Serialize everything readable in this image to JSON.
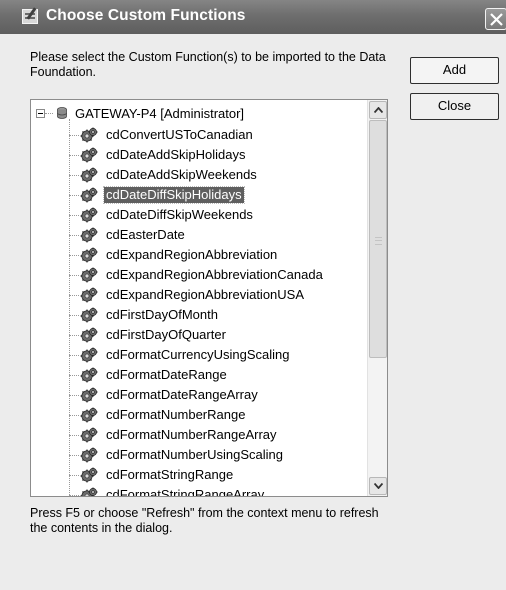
{
  "window": {
    "title": "Choose Custom Functions",
    "instructions": "Please select the Custom Function(s) to be imported to the Data Foundation.",
    "hint": "Press F5 or choose \"Refresh\" from the context menu to refresh the contents in the dialog."
  },
  "buttons": {
    "add": "Add",
    "close": "Close"
  },
  "tree": {
    "root_label": "GATEWAY-P4 [Administrator]",
    "selected_index": 3,
    "items": [
      "cdConvertUSToCanadian",
      "cdDateAddSkipHolidays",
      "cdDateAddSkipWeekends",
      "cdDateDiffSkipHolidays",
      "cdDateDiffSkipWeekends",
      "cdEasterDate",
      "cdExpandRegionAbbreviation",
      "cdExpandRegionAbbreviationCanada",
      "cdExpandRegionAbbreviationUSA",
      "cdFirstDayOfMonth",
      "cdFirstDayOfQuarter",
      "cdFormatCurrencyUsingScaling",
      "cdFormatDateRange",
      "cdFormatDateRangeArray",
      "cdFormatNumberRange",
      "cdFormatNumberRangeArray",
      "cdFormatNumberUsingScaling",
      "cdFormatStringRange",
      "cdFormatStringRangeArray"
    ]
  },
  "icons": {
    "app": "dialog-app-icon",
    "close": "close-icon",
    "collapse": "collapse-minus-icon",
    "database": "database-icon",
    "function": "custom-function-icon",
    "scroll_up": "scroll-up-arrow-icon",
    "scroll_down": "scroll-down-arrow-icon"
  }
}
